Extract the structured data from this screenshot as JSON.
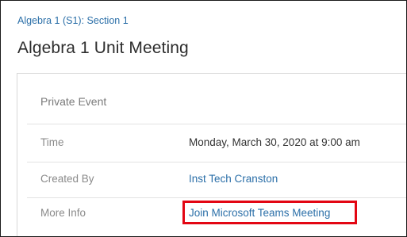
{
  "breadcrumb": "Algebra 1 (S1): Section 1",
  "title": "Algebra 1 Unit Meeting",
  "event": {
    "privacy": "Private Event",
    "rows": [
      {
        "label": "Time",
        "value": "Monday, March 30, 2020 at 9:00 am"
      },
      {
        "label": "Created By",
        "value": "Inst Tech Cranston"
      },
      {
        "label": "More Info",
        "value": "Join Microsoft Teams Meeting"
      }
    ]
  },
  "accent": {
    "link": "#2b6fa8",
    "highlight": "#e30613"
  }
}
